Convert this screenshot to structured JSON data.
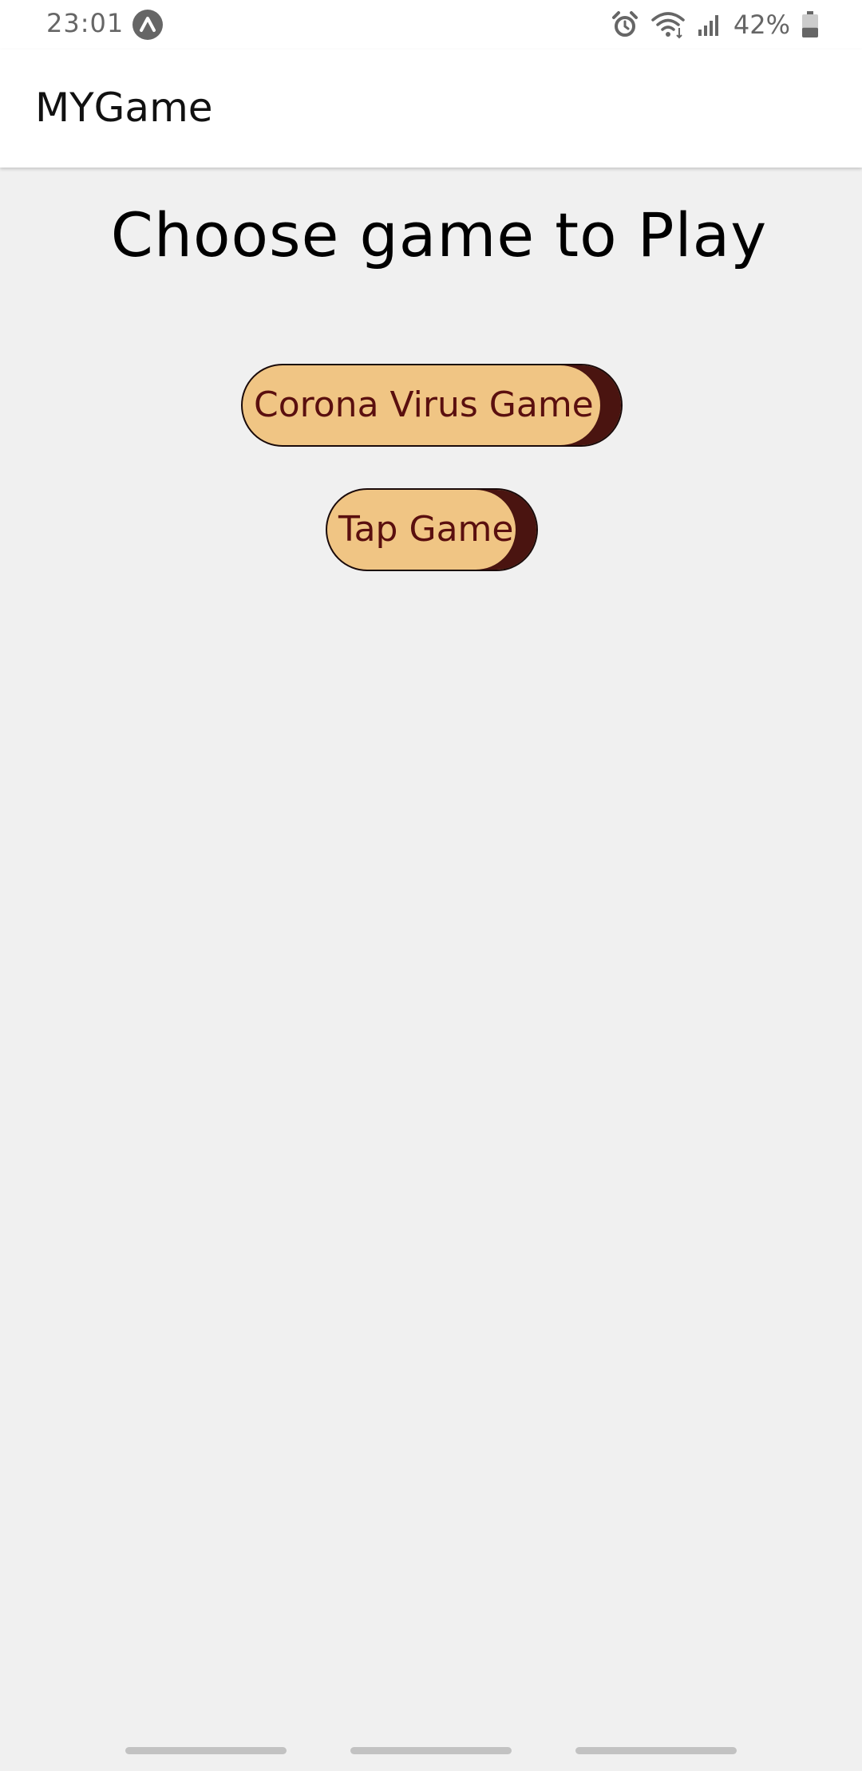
{
  "status_bar": {
    "time": "23:01",
    "battery_percent": "42%",
    "icons": [
      "app-notification-icon",
      "alarm-icon",
      "wifi-icon",
      "signal-icon",
      "battery-icon"
    ],
    "battery_level": 0.42
  },
  "app_bar": {
    "title": "MYGame"
  },
  "main": {
    "heading": "Choose game to Play",
    "buttons": [
      {
        "label": "Corona Virus Game"
      },
      {
        "label": "Tap Game"
      }
    ]
  },
  "colors": {
    "background": "#f0f0f0",
    "button_fill": "#f0c584",
    "button_accent": "#4a1410",
    "button_text": "#5a0f0f"
  }
}
